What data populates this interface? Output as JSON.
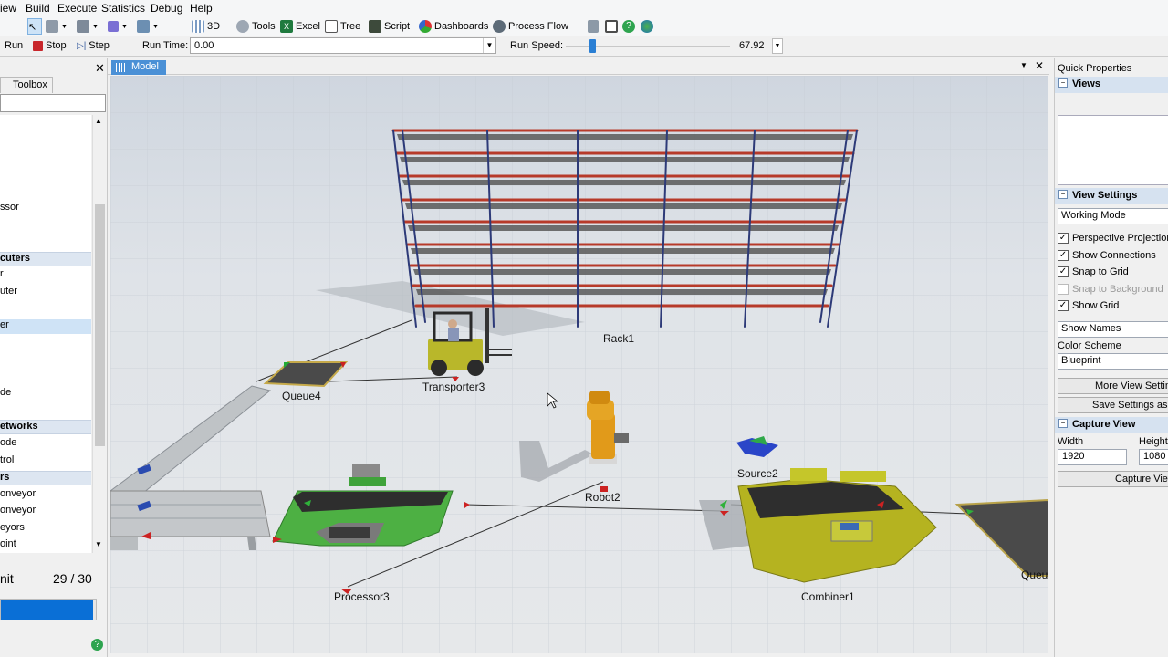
{
  "menu": [
    "iew",
    "Build",
    "Execute",
    "Statistics",
    "Debug",
    "Help"
  ],
  "toolbar": {
    "btn_3d": "3D",
    "btn_tools": "Tools",
    "btn_excel": "Excel",
    "btn_tree": "Tree",
    "btn_script": "Script",
    "btn_dashboards": "Dashboards",
    "btn_processflow": "Process Flow"
  },
  "runbar": {
    "run": "Run",
    "stop": "Stop",
    "step": "Step",
    "runtime_label": "Run Time:",
    "runtime_value": "0.00",
    "runspeed_label": "Run Speed:",
    "runspeed_value": "67.92"
  },
  "leftpanel": {
    "tab": "Toolbox",
    "items": [
      {
        "label": "ssor",
        "kind": "item"
      },
      {
        "label": "cuters",
        "kind": "group"
      },
      {
        "label": "r",
        "kind": "item"
      },
      {
        "label": "uter",
        "kind": "item"
      },
      {
        "label": "er",
        "kind": "selected"
      },
      {
        "label": "de",
        "kind": "item"
      },
      {
        "label": "etworks",
        "kind": "group"
      },
      {
        "label": "ode",
        "kind": "item"
      },
      {
        "label": "trol",
        "kind": "item"
      },
      {
        "label": "rs",
        "kind": "group"
      },
      {
        "label": "onveyor",
        "kind": "item"
      },
      {
        "label": "onveyor",
        "kind": "item"
      },
      {
        "label": "eyors",
        "kind": "item"
      },
      {
        "label": "oint",
        "kind": "item"
      }
    ],
    "progress_label": "nit",
    "progress_count": "29 / 30",
    "progress_fraction": 0.97
  },
  "model": {
    "tab": "Model",
    "objects": {
      "rack": "Rack1",
      "transporter": "Transporter3",
      "queue4": "Queue4",
      "robot": "Robot2",
      "source": "Source2",
      "processor": "Processor3",
      "combiner": "Combiner1",
      "queue_partial": "Queu"
    }
  },
  "rightpanel": {
    "title": "Quick Properties",
    "views_header": "Views",
    "view_settings_header": "View Settings",
    "working_mode": "Working Mode",
    "checkboxes": [
      {
        "label": "Perspective Projection",
        "checked": true,
        "enabled": true
      },
      {
        "label": "Show Connections",
        "checked": true,
        "enabled": true
      },
      {
        "label": "Snap to Grid",
        "checked": true,
        "enabled": true
      },
      {
        "label": "Snap to Background",
        "checked": false,
        "enabled": false
      },
      {
        "label": "Show Grid",
        "checked": true,
        "enabled": true
      }
    ],
    "show_names": "Show Names",
    "color_scheme_label": "Color Scheme",
    "color_scheme_value": "Blueprint",
    "more_view_settings": "More View Setting",
    "save_settings": "Save Settings as D",
    "capture_view_header": "Capture View",
    "width_label": "Width",
    "height_label": "Height",
    "width_value": "1920",
    "height_value": "1080",
    "capture_button": "Capture View"
  }
}
